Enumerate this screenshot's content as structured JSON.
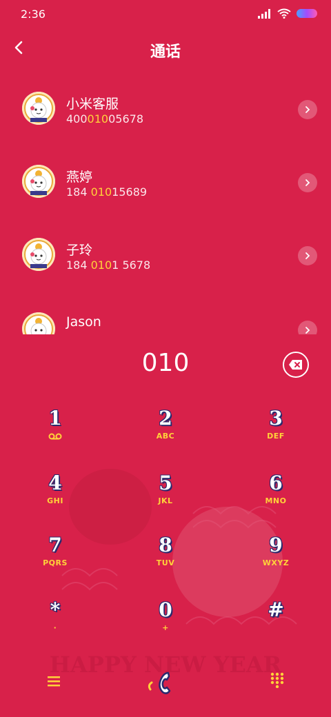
{
  "status": {
    "time": "2:36"
  },
  "header": {
    "title": "通话"
  },
  "calls": [
    {
      "name": "小米客服",
      "number_pre": "400",
      "number_match": "010",
      "number_post": "05678"
    },
    {
      "name": "燕婷",
      "number_pre": "184 ",
      "number_match": "010",
      "number_post": "15689"
    },
    {
      "name": "子玲",
      "number_pre": "184 ",
      "number_match": "010",
      "number_post": "1 5678"
    },
    {
      "name": "Jason"
    }
  ],
  "dial": {
    "input": "010"
  },
  "keys": [
    {
      "digit": "1",
      "letters": ""
    },
    {
      "digit": "2",
      "letters": "ABC"
    },
    {
      "digit": "3",
      "letters": "DEF"
    },
    {
      "digit": "4",
      "letters": "GHI"
    },
    {
      "digit": "5",
      "letters": "JKL"
    },
    {
      "digit": "6",
      "letters": "MNO"
    },
    {
      "digit": "7",
      "letters": "PQRS"
    },
    {
      "digit": "8",
      "letters": "TUV"
    },
    {
      "digit": "9",
      "letters": "WXYZ"
    },
    {
      "digit": "*",
      "letters": "·"
    },
    {
      "digit": "0",
      "letters": "+"
    },
    {
      "digit": "#",
      "letters": ""
    }
  ],
  "decoration": {
    "banner": "HAPPY NEW YEAR"
  },
  "colors": {
    "background": "#d8214a",
    "accent": "#ffd23a",
    "key_outline": "#2a2a6e"
  },
  "icons": {
    "voicemail": "voicemail-icon",
    "call": "phone-icon",
    "menu": "menu-icon",
    "keypad": "dialpad-icon"
  }
}
